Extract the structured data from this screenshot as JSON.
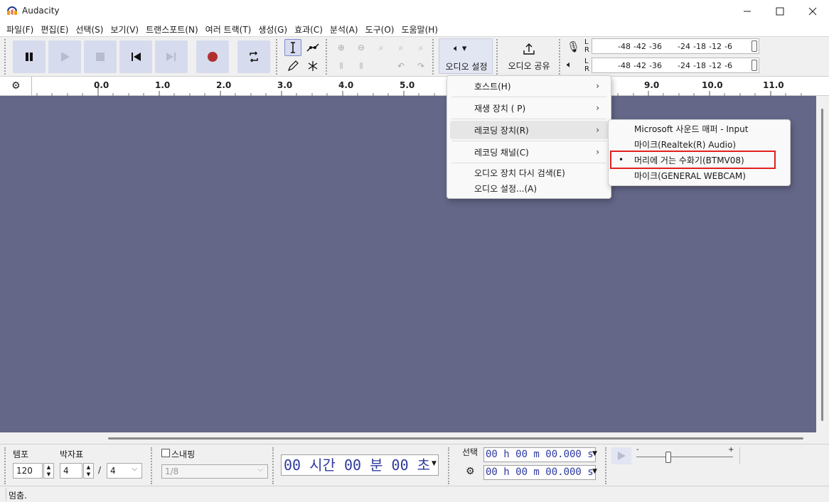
{
  "window": {
    "title": "Audacity",
    "min_icon": "minimize-icon",
    "max_icon": "maximize-icon",
    "close_icon": "close-icon"
  },
  "menubar": [
    "파일(F)",
    "편집(E)",
    "선택(S)",
    "보기(V)",
    "트랜스포트(N)",
    "여러 트랙(T)",
    "생성(G)",
    "효과(C)",
    "분석(A)",
    "도구(O)",
    "도움말(H)"
  ],
  "toolbar": {
    "audio_setup_label": "오디오 설정",
    "share_audio_label": "오디오 공유"
  },
  "meters": {
    "L": "L",
    "R": "R",
    "scale": [
      "-48",
      "-42",
      "-36",
      "-24",
      "-18",
      "-12",
      "-6"
    ]
  },
  "ruler": {
    "ticks": [
      "0.0",
      "1.0",
      "2.0",
      "3.0",
      "4.0",
      "5.0",
      "9.0",
      "10.0",
      "11.0"
    ]
  },
  "audio_setup_menu": {
    "items": [
      {
        "label": "호스트(H)",
        "submenu": true
      },
      {
        "label": "재생 장치 ( P)",
        "submenu": true
      },
      {
        "label": "레코딩 장치(R)",
        "submenu": true,
        "highlighted": true
      },
      {
        "label": "레코딩 채널(C)",
        "submenu": true
      },
      {
        "label": "오디오 장치 다시 검색(E)",
        "submenu": false
      },
      {
        "label": "오디오 설정...(A)",
        "submenu": false
      }
    ]
  },
  "recording_device_submenu": {
    "items": [
      {
        "label": "Microsoft 사운드 매퍼 - Input",
        "selected": false
      },
      {
        "label": "마이크(Realtek(R) Audio)",
        "selected": false
      },
      {
        "label": "머리에 거는 수화기(BTMV08)",
        "selected": true
      },
      {
        "label": "마이크(GENERAL WEBCAM)",
        "selected": false
      }
    ],
    "bullet": "•",
    "highlight_color": "#e02020"
  },
  "bottom": {
    "tempo_label": "템포",
    "tempo_value": "120",
    "timesig_label": "박자표",
    "timesig_num": "4",
    "timesig_slash": "/",
    "timesig_den": "4",
    "snap_label": "스내핑",
    "snap_value": "1/8",
    "time_display": "00 시간 00 분 00 초",
    "selection_label": "선택",
    "sel_start": "00 h 00 m 00.000 s",
    "sel_end": "00 h 00 m 00.000 s",
    "play_speed_minus": "-",
    "play_speed_plus": "+"
  },
  "status": {
    "text": "멈춤."
  },
  "colors": {
    "track_bg": "#646788",
    "button_bg": "#d7dbee",
    "record": "#b03030"
  }
}
